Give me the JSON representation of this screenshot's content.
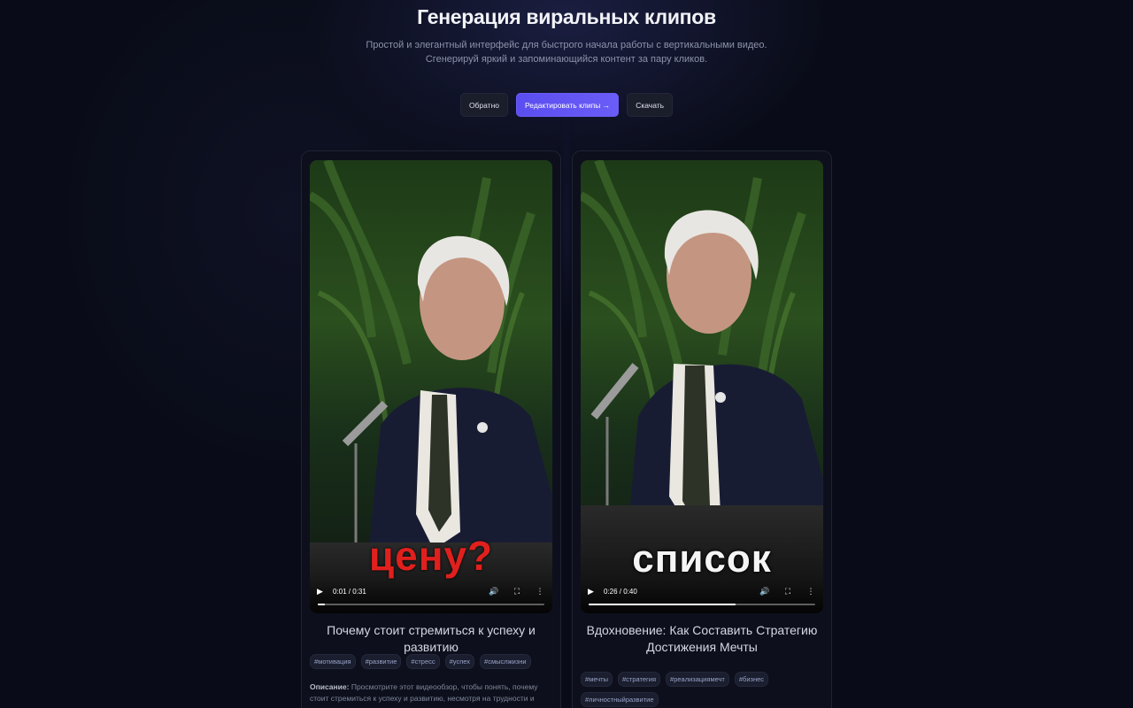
{
  "header": {
    "title": "Генерация виральных клипов",
    "subtitle_line1": "Простой и элегантный интерфейс для быстрого начала работы с вертикальными видео.",
    "subtitle_line2": "Сгенерируй яркий и запоминающийся контент за пару кликов."
  },
  "actions": {
    "back_label": "Обратно",
    "edit_label": "Редактировать клипы →",
    "download_label": "Скачать"
  },
  "clips": [
    {
      "caption": "цену?",
      "time": "0:01 / 0:31",
      "progress": 0.03,
      "title": "Почему стоит стремиться к успеху и развитию",
      "tags": [
        "#мотивация",
        "#развитие",
        "#стресс",
        "#успех",
        "#смыслжизни"
      ],
      "desc_label": "Описание:",
      "description": "Просмотрите этот видеообзор, чтобы понять, почему стоит стремиться к успеху и развитию, несмотря на трудности и вызовы, которые могут встретиться на пути."
    },
    {
      "caption": "список",
      "time": "0:26 / 0:40",
      "progress": 0.65,
      "title": "Вдохновение: Как Составить Стратегию Достижения Мечты",
      "tags": [
        "#мечты",
        "#стратегия",
        "#реализациямечт",
        "#бизнес",
        "#личностныйразвитие"
      ]
    }
  ],
  "colors": {
    "background": "#090c18",
    "primary": "#5b4ef0",
    "caption_red": "#e0201d"
  }
}
